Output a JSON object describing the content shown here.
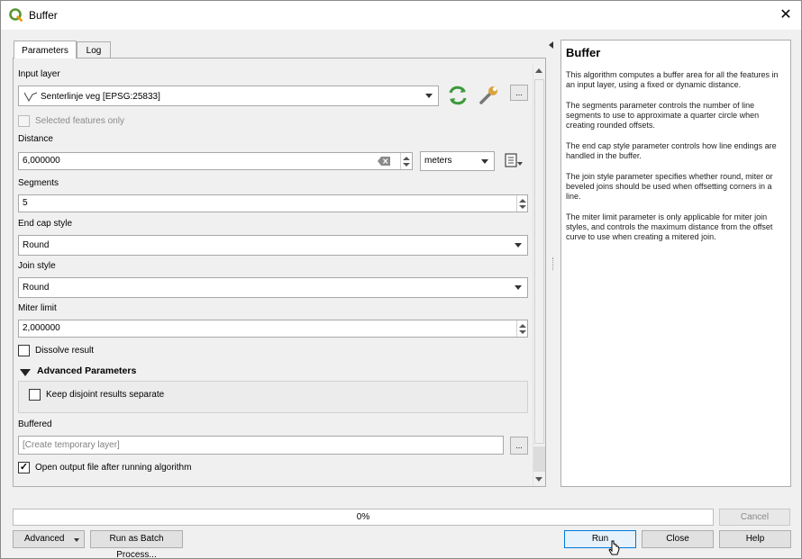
{
  "window": {
    "title": "Buffer",
    "close_symbol": "✕"
  },
  "tabs": [
    {
      "label": "Parameters"
    },
    {
      "label": "Log"
    }
  ],
  "params": {
    "input_layer": {
      "label": "Input layer",
      "value": "Senterlinje veg [EPSG:25833]",
      "dots": "..."
    },
    "selected_only": {
      "label": "Selected features only",
      "checked": false
    },
    "distance": {
      "label": "Distance",
      "value": "6,000000",
      "unit": "meters"
    },
    "segments": {
      "label": "Segments",
      "value": "5"
    },
    "end_cap": {
      "label": "End cap style",
      "value": "Round"
    },
    "join_style": {
      "label": "Join style",
      "value": "Round"
    },
    "miter_limit": {
      "label": "Miter limit",
      "value": "2,000000"
    },
    "dissolve": {
      "label": "Dissolve result",
      "checked": false
    },
    "advanced": {
      "label": "Advanced Parameters"
    },
    "keep_disjoint": {
      "label": "Keep disjoint results separate",
      "checked": false
    },
    "buffered": {
      "label": "Buffered",
      "placeholder": "[Create temporary layer]",
      "dots": "..."
    },
    "open_output": {
      "label": "Open output file after running algorithm",
      "checked": true,
      "mark": "✓"
    }
  },
  "help": {
    "title": "Buffer",
    "paragraphs": [
      "This algorithm computes a buffer area for all the features in an input layer, using a fixed or dynamic distance.",
      "The segments parameter controls the number of line segments to use to approximate a quarter circle when creating rounded offsets.",
      "The end cap style parameter controls how line endings are handled in the buffer.",
      "The join style parameter specifies whether round, miter or beveled joins should be used when offsetting corners in a line.",
      "The miter limit parameter is only applicable for miter join styles, and controls the maximum distance from the offset curve to use when creating a mitered join."
    ]
  },
  "progress": {
    "text": "0%",
    "value": 0
  },
  "buttons": {
    "cancel": "Cancel",
    "advanced": "Advanced",
    "batch": "Run as Batch Process...",
    "run": "Run",
    "close": "Close",
    "help": "Help"
  },
  "colors": {
    "accent": "#0078d7",
    "refresh_green": "#3c9a3c",
    "qgis_green": "#589632"
  }
}
